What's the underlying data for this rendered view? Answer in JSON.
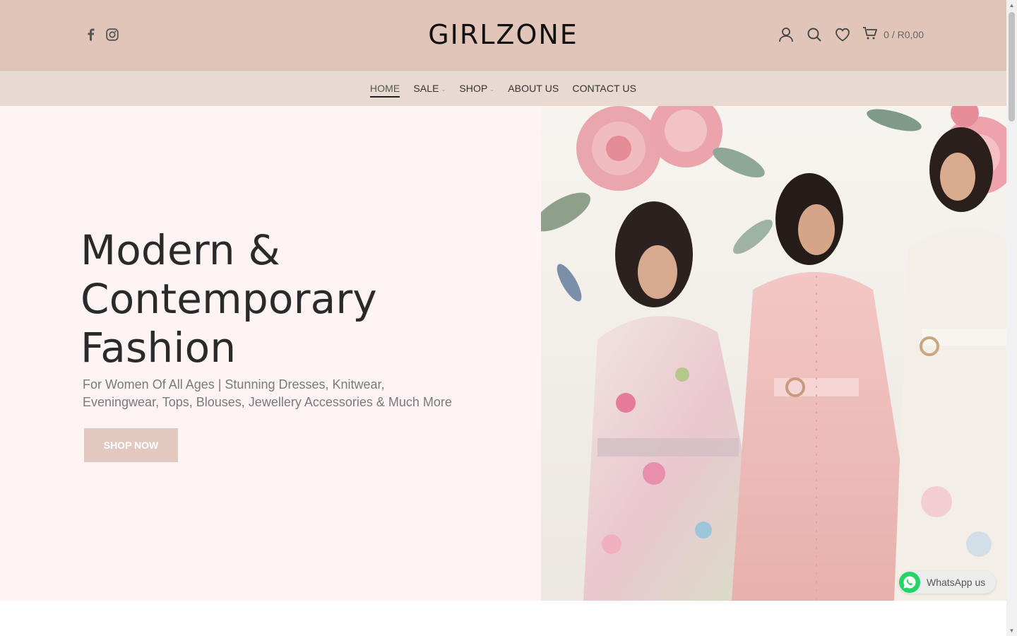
{
  "header": {
    "logo": "GIRLZONE",
    "social": [
      {
        "icon": "facebook-icon"
      },
      {
        "icon": "instagram-icon"
      }
    ],
    "tools": {
      "account_icon": "user-icon",
      "search_icon": "search-icon",
      "wishlist_icon": "heart-icon",
      "cart_icon": "cart-icon",
      "cart_text": "0 / R0,00"
    }
  },
  "nav": {
    "items": [
      {
        "label": "HOME",
        "active": true,
        "dropdown": false
      },
      {
        "label": "SALE",
        "active": false,
        "dropdown": true
      },
      {
        "label": "SHOP",
        "active": false,
        "dropdown": true
      },
      {
        "label": "ABOUT US",
        "active": false,
        "dropdown": false
      },
      {
        "label": "CONTACT US",
        "active": false,
        "dropdown": false
      }
    ]
  },
  "hero": {
    "title_line1": "Modern &",
    "title_line2": "Contemporary",
    "title_line3": "Fashion",
    "subtitle": "For Women Of All Ages | Stunning Dresses, Knitwear, Eveningwear, Tops, Blouses, Jewellery Accessories & Much More",
    "button": "SHOP NOW",
    "image_icon": "hero-photo-three-women-floral-dresses"
  },
  "whatsapp": {
    "label": "WhatsApp us",
    "icon": "whatsapp-icon"
  },
  "colors": {
    "header_bg": "#e1c5b8",
    "nav_bg": "#e8d9d2",
    "hero_bg": "#fdf4f3",
    "button_bg": "#e2c9c0",
    "whatsapp_green": "#25d366"
  }
}
